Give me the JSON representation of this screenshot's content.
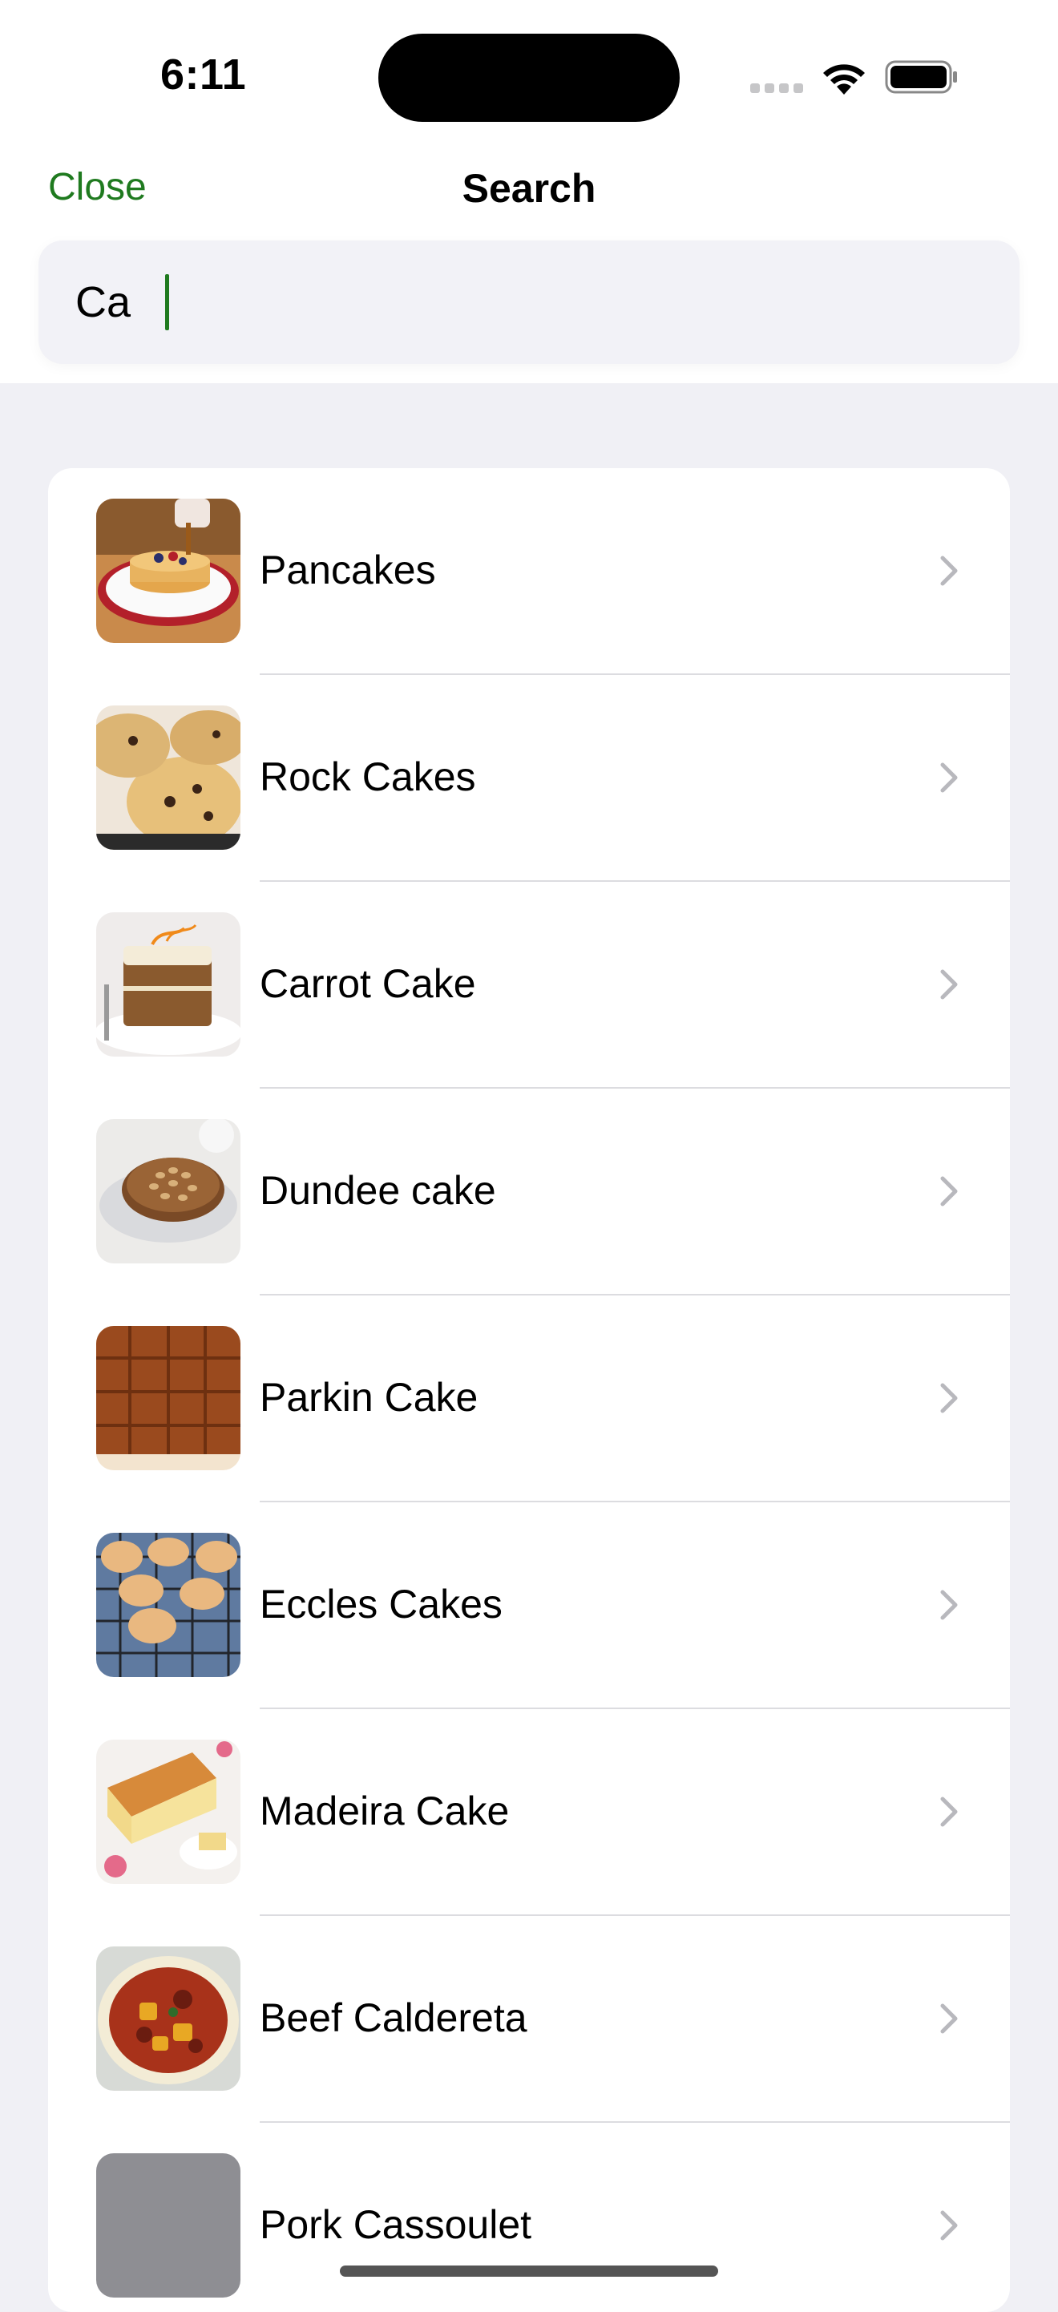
{
  "status_bar": {
    "time": "6:11"
  },
  "nav": {
    "close_label": "Close",
    "title": "Search"
  },
  "search": {
    "value": "Ca"
  },
  "colors": {
    "accent": "#1f7a1f",
    "background": "#f0f0f5",
    "card": "#ffffff"
  },
  "results": [
    {
      "name": "Pancakes",
      "thumb": "pancakes-photo"
    },
    {
      "name": "Rock Cakes",
      "thumb": "rock-cakes-photo"
    },
    {
      "name": "Carrot Cake",
      "thumb": "carrot-cake-photo"
    },
    {
      "name": "Dundee cake",
      "thumb": "dundee-cake-photo"
    },
    {
      "name": "Parkin Cake",
      "thumb": "parkin-cake-photo"
    },
    {
      "name": "Eccles Cakes",
      "thumb": "eccles-cakes-photo"
    },
    {
      "name": "Madeira Cake",
      "thumb": "madeira-cake-photo"
    },
    {
      "name": "Beef Caldereta",
      "thumb": "beef-caldereta-photo"
    },
    {
      "name": "Pork Cassoulet",
      "thumb": "placeholder-image"
    }
  ]
}
